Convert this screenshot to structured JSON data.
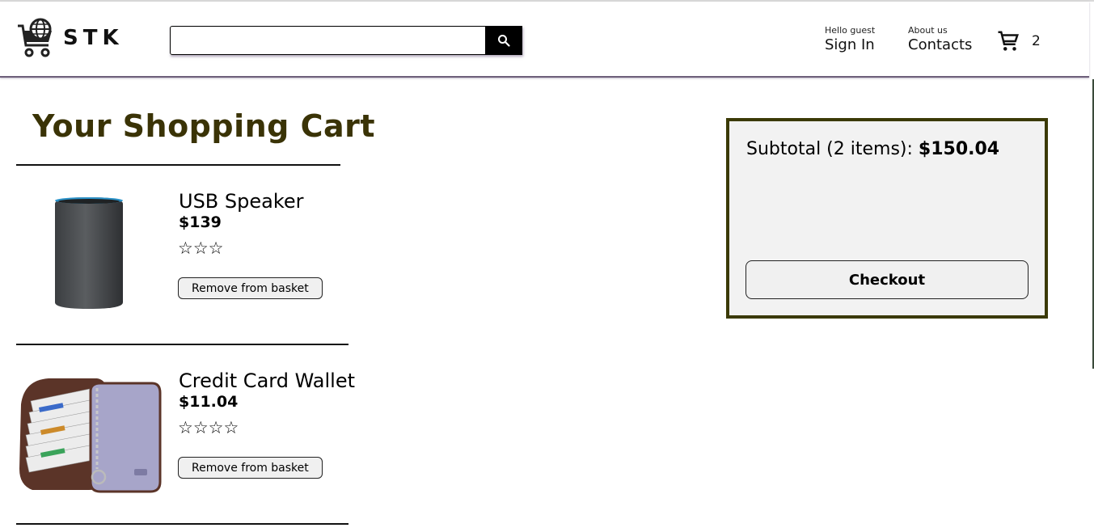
{
  "header": {
    "logo_text": "STK",
    "search": {
      "value": "",
      "placeholder": ""
    },
    "signin": {
      "small": "Hello guest",
      "big": "Sign In"
    },
    "contacts": {
      "small": "About us",
      "big": "Contacts"
    },
    "cart_count": "2"
  },
  "cart": {
    "title": "Your Shopping Cart",
    "items": [
      {
        "name": "USB Speaker",
        "price": "$139",
        "stars": "☆☆☆",
        "rating": 3,
        "remove_label": "Remove from basket",
        "image": "speaker-image"
      },
      {
        "name": "Credit Card Wallet",
        "price": "$11.04",
        "stars": "☆☆☆☆",
        "rating": 4,
        "remove_label": "Remove from basket",
        "image": "wallet-image"
      }
    ]
  },
  "summary": {
    "subtotal_label": "Subtotal (2 items): ",
    "subtotal_value": "$150.04",
    "checkout_label": "Checkout"
  },
  "colors": {
    "title": "#3a3306",
    "summary_border": "#3b3a06",
    "summary_bg": "#f2f2f2"
  }
}
